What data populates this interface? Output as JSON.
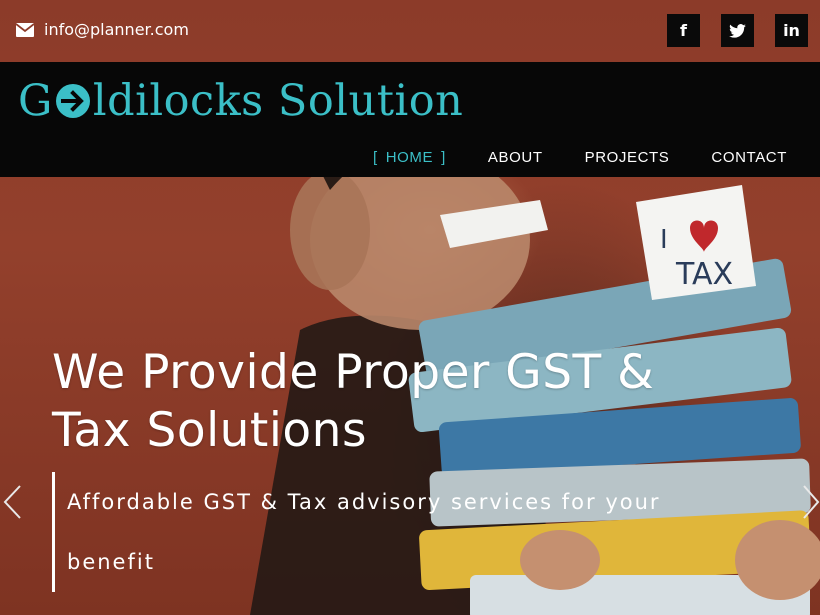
{
  "topbar": {
    "email": "info@planner.com",
    "email_icon": "envelope-icon",
    "social": [
      {
        "name": "facebook",
        "glyph": "f"
      },
      {
        "name": "twitter",
        "glyph": "t"
      },
      {
        "name": "linkedin",
        "glyph": "in"
      }
    ]
  },
  "brand": {
    "logo_first": "G",
    "logo_rest": "ldilocks Solution",
    "logo_icon": "arrow-circle-icon",
    "color": "#3bbfc7"
  },
  "nav": {
    "items": [
      {
        "label": "HOME",
        "active": true
      },
      {
        "label": "ABOUT",
        "active": false
      },
      {
        "label": "PROJECTS",
        "active": false
      },
      {
        "label": "CONTACT",
        "active": false
      }
    ],
    "active_open": "[",
    "active_close": "]"
  },
  "hero": {
    "headline_line1": "We Provide Proper GST &",
    "headline_line2": "Tax Solutions",
    "tagline": "Affordable GST & Tax advisory services for your benefit",
    "prev_icon": "chevron-left-icon",
    "next_icon": "chevron-right-icon",
    "sign_text_1": "I",
    "sign_text_2": "TAX"
  }
}
